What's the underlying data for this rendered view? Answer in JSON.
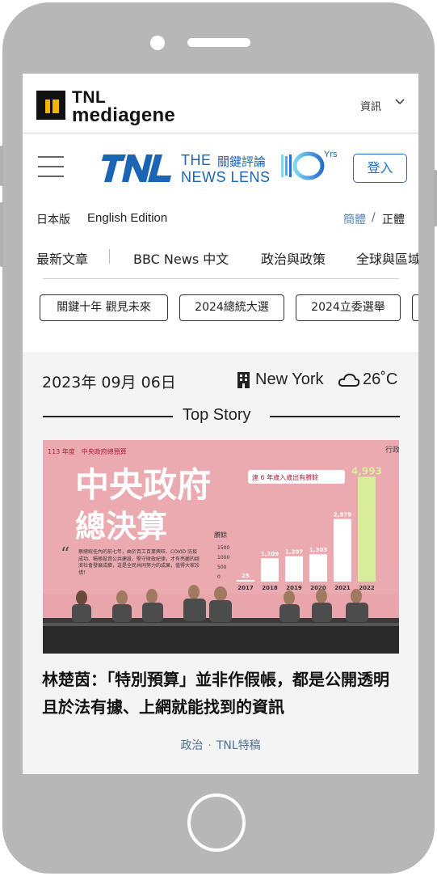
{
  "topbar": {
    "brand_line1": "TNL",
    "brand_line2": "mediagene",
    "info_select": "資訊"
  },
  "header": {
    "title_en1": "THE",
    "title_zh": "關鍵評論",
    "title_en2": "NEWS LENS",
    "anniv_yrs": "Yrs",
    "login": "登入"
  },
  "editions": {
    "jp": "日本版",
    "en": "English Edition",
    "simplified": "簡體",
    "separator": "/",
    "traditional": "正體"
  },
  "nav": {
    "items": [
      "最新文章",
      "BBC News 中文",
      "政治與政策",
      "全球與區域"
    ]
  },
  "chips": [
    "關鍵十年 觀見未來",
    "2024總統大選",
    "2024立委選舉"
  ],
  "story": {
    "date": "2023年 09月 06日",
    "city": "New York",
    "temperature": "26˚C",
    "section_label": "Top Story",
    "headline": "林楚茵：「特別預算」並非作假帳，都是公開透明且於法有據、上網就能找到的資訊",
    "tag_category": "政治",
    "tag_source": "TNL特稿"
  },
  "photo": {
    "small_title": "113 年度　中央政府總預算",
    "corner_text": "行政",
    "big_line1": "中央政府",
    "big_line2": "總決算",
    "badge": "連 6 年歲入歲出有賸餘",
    "quote": "蔡總統任內的前七年，由於百工百業興旺、COVID 防疫成功、積極投資公共建設、堅守財政紀律，才有亮麗的經濟社會發展成績，這是全民共同努力的成果，值得大家珍惜！",
    "axis_label": "賸餘"
  },
  "chart_data": {
    "type": "bar",
    "categories": [
      "2017",
      "2018",
      "2019",
      "2020",
      "2021",
      "2022"
    ],
    "values": [
      25,
      1109,
      1207,
      1303,
      2979,
      4993
    ],
    "value_labels": [
      "25",
      "1,109",
      "1,207",
      "1,303",
      "2,979",
      "4,993"
    ],
    "y_ticks": [
      "1500",
      "1000",
      "500",
      "0"
    ],
    "ylim": [
      0,
      5200
    ]
  },
  "colors": {
    "brand_blue": "#1c64b4",
    "login_blue": "#1f6fc6",
    "photo_pink": "#e8a4aa"
  }
}
